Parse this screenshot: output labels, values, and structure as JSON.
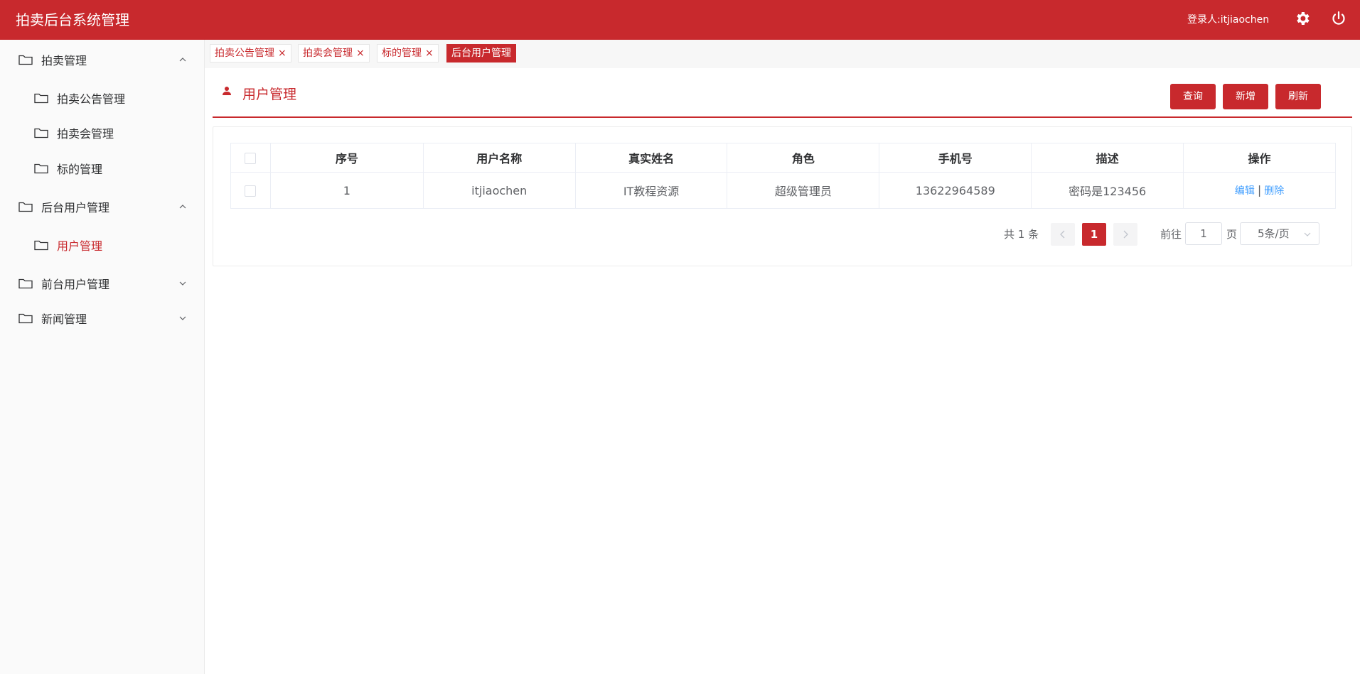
{
  "app": {
    "title": "拍卖后台系统管理",
    "user_label": "登录人:itjiaochen"
  },
  "sidebar": {
    "groups": [
      {
        "label": "拍卖管理",
        "expanded": true
      },
      {
        "label": "拍卖公告管理"
      },
      {
        "label": "拍卖会管理"
      },
      {
        "label": "标的管理"
      },
      {
        "label": "后台用户管理",
        "expanded": true
      },
      {
        "label": "用户管理",
        "active": true
      },
      {
        "label": "前台用户管理",
        "expanded": false
      },
      {
        "label": "新闻管理",
        "expanded": false
      }
    ]
  },
  "tabs": [
    {
      "label": "拍卖公告管理",
      "close": "×"
    },
    {
      "label": "拍卖会管理",
      "close": "×"
    },
    {
      "label": "标的管理",
      "close": "×"
    },
    {
      "label": "后台用户管理",
      "current": true
    }
  ],
  "page": {
    "title": "用户管理",
    "buttons": {
      "query": "查询",
      "add": "新增",
      "refresh": "刷新"
    }
  },
  "table": {
    "columns": [
      "序号",
      "用户名称",
      "真实姓名",
      "角色",
      "手机号",
      "描述",
      "操作"
    ],
    "rows": [
      {
        "index": "1",
        "username": "itjiaochen",
        "realname": "IT教程资源",
        "role": "超级管理员",
        "phone": "13622964589",
        "desc": "密码是123456",
        "edit": "编辑",
        "sep": "|",
        "delete": "删除"
      }
    ]
  },
  "pagination": {
    "total": "共 1 条",
    "current": "1",
    "goto_label": "前往",
    "goto_value": "1",
    "page_label": "页",
    "page_size": "5条/页"
  },
  "colors": {
    "accent": "#c8292d",
    "link": "#409eff"
  }
}
